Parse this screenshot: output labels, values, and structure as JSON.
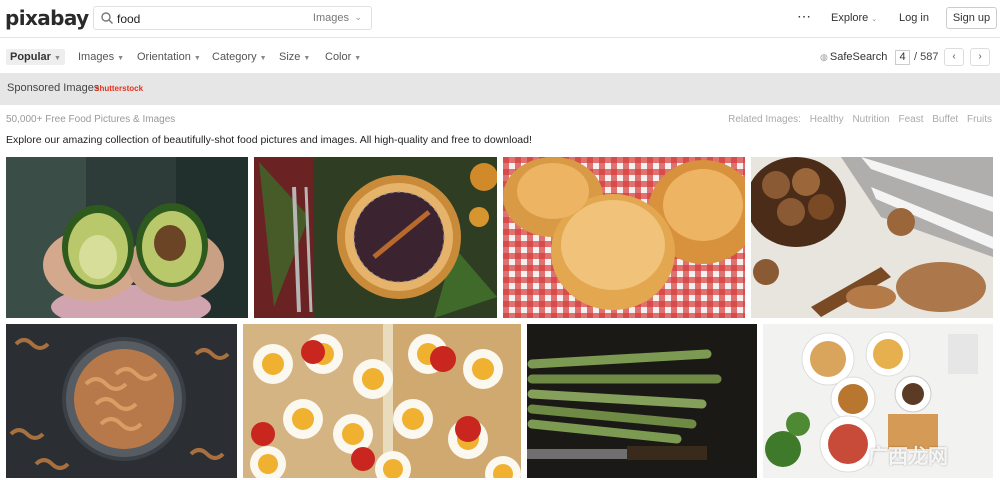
{
  "header": {
    "logo_text": "pixabay",
    "search_query": "food",
    "search_type": "Images",
    "explore_label": "Explore",
    "login_label": "Log in",
    "signup_label": "Sign up",
    "more_icon": "⋯"
  },
  "filters": {
    "items": [
      "Popular",
      "Images",
      "Orientation",
      "Category",
      "Size",
      "Color"
    ],
    "safesearch_label": "SafeSearch",
    "current_page": "4",
    "total_pages": "/ 587",
    "prev_icon": "‹",
    "next_icon": "›"
  },
  "sponsor": {
    "label": "Sponsored Images",
    "brand": "shutterstock"
  },
  "results": {
    "count_line": "50,000+ Free Food Pictures & Images",
    "related_label": "Related Images:",
    "related_tags": [
      "Healthy",
      "Nutrition",
      "Feast",
      "Buffet",
      "Fruits"
    ],
    "description": "Explore our amazing collection of beautifully-shot food pictures and images. All high-quality and free to download!"
  },
  "gallery": [
    {
      "name": "avocado",
      "colors": [
        "#2f3e3a",
        "#c9a48a"
      ]
    },
    {
      "name": "chocolate-cake",
      "colors": [
        "#2e3a22",
        "#b45b2a"
      ]
    },
    {
      "name": "bread-rolls",
      "colors": [
        "#c9302c",
        "#e0a35a"
      ]
    },
    {
      "name": "walnuts",
      "colors": [
        "#e8e4de",
        "#7a4a25"
      ]
    },
    {
      "name": "pasta",
      "colors": [
        "#2a2e33",
        "#b77a4a"
      ]
    },
    {
      "name": "egg-toast",
      "colors": [
        "#f2e8cf",
        "#f0b030"
      ]
    },
    {
      "name": "asparagus",
      "colors": [
        "#1c1a17",
        "#6e8a45"
      ]
    },
    {
      "name": "breakfast-spread",
      "colors": [
        "#f3f3f1",
        "#8a6a4a"
      ]
    }
  ],
  "watermark": "广西龙网"
}
